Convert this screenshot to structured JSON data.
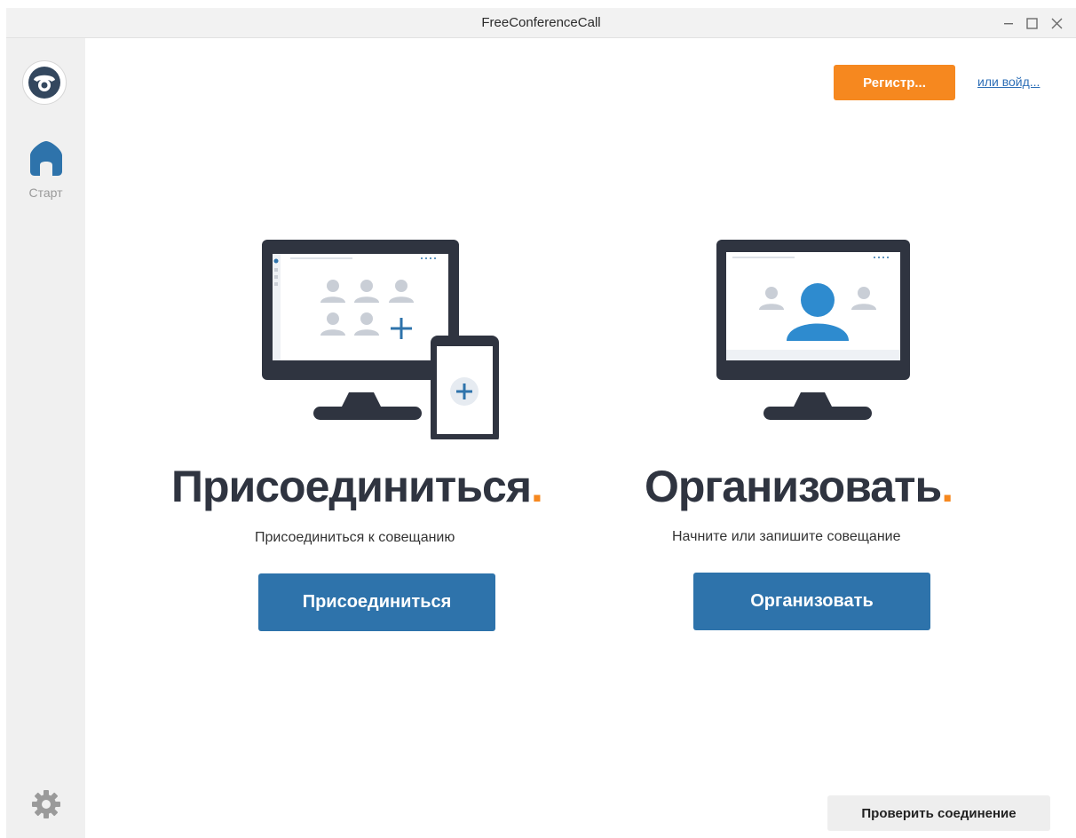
{
  "window": {
    "title": "FreeConferenceCall",
    "controls": {
      "minimize": "–",
      "maximize": "☐",
      "close": "✕"
    }
  },
  "sidebar": {
    "logo_icon": "telephone-logo-icon",
    "items": [
      {
        "label": "Старт",
        "icon": "home-icon",
        "active": true
      }
    ],
    "settings_icon": "gear-icon"
  },
  "header": {
    "register_label": "Регистр...",
    "login_link": "или войд..."
  },
  "join": {
    "heading": "Присоединиться",
    "dot": ".",
    "subtitle": "Присоединиться к совещанию",
    "button_label": "Присоединиться"
  },
  "host": {
    "heading": "Организовать",
    "dot": ".",
    "subtitle": "Начните или запишите совещание",
    "button_label": "Организовать"
  },
  "footer": {
    "check_connection_label": "Проверить соединение"
  },
  "colors": {
    "accent_orange": "#f6881f",
    "primary_blue": "#2e73ab",
    "heading_dark": "#2f3440",
    "link_blue": "#2e6fb7"
  }
}
